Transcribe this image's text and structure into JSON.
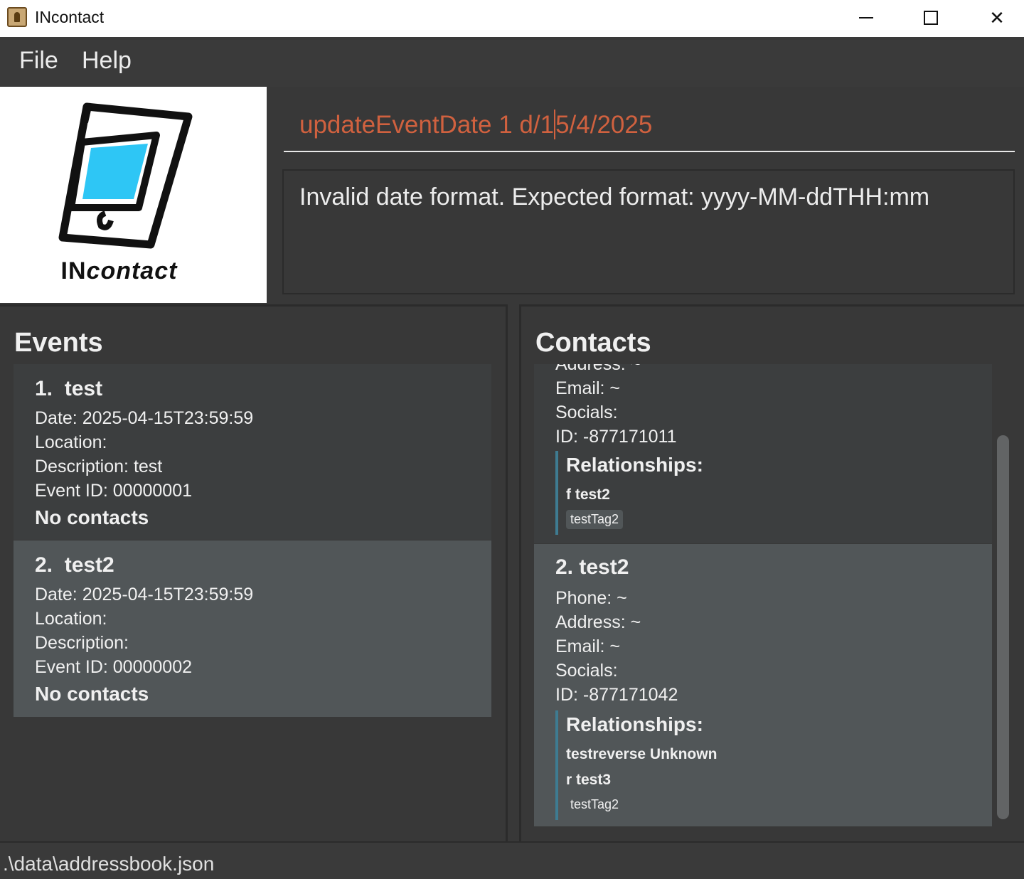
{
  "window": {
    "title": "INcontact"
  },
  "menu": {
    "file": "File",
    "help": "Help"
  },
  "logo": {
    "text_caps": "IN",
    "text_italic": "contact"
  },
  "command": {
    "before_caret": "updateEventDate 1 d/1",
    "after_caret": "5/4/2025"
  },
  "result": {
    "message": "Invalid date format. Expected format: yyyy-MM-ddTHH:mm"
  },
  "events": {
    "title": "Events",
    "items": [
      {
        "index": "1.",
        "name": "test",
        "date": "Date: 2025-04-15T23:59:59",
        "location": "Location:",
        "description": "Description: test",
        "event_id": "Event ID: 00000001",
        "contacts": "No contacts"
      },
      {
        "index": "2.",
        "name": "test2",
        "date": "Date: 2025-04-15T23:59:59",
        "location": "Location:",
        "description": "Description:",
        "event_id": "Event ID: 00000002",
        "contacts": "No contacts"
      }
    ]
  },
  "contacts": {
    "title": "Contacts",
    "items": [
      {
        "address": "Address: ~",
        "email": "Email: ~",
        "socials": "Socials:",
        "id": "ID: -877171011",
        "relationships_title": "Relationships:",
        "relationships": [
          "f  test2"
        ],
        "tag": "testTag2"
      },
      {
        "heading": "2. test2",
        "phone": "Phone: ~",
        "address": "Address: ~",
        "email": "Email: ~",
        "socials": "Socials:",
        "id": "ID: -877171042",
        "relationships_title": "Relationships:",
        "relationships": [
          "testreverse  Unknown",
          "r  test3"
        ],
        "tag": "testTag2"
      }
    ]
  },
  "status": {
    "path": ".\\data\\addressbook.json"
  },
  "colors": {
    "command_text": "#d0613f",
    "relationship_bar": "#3e7b91",
    "background": "#383838"
  }
}
